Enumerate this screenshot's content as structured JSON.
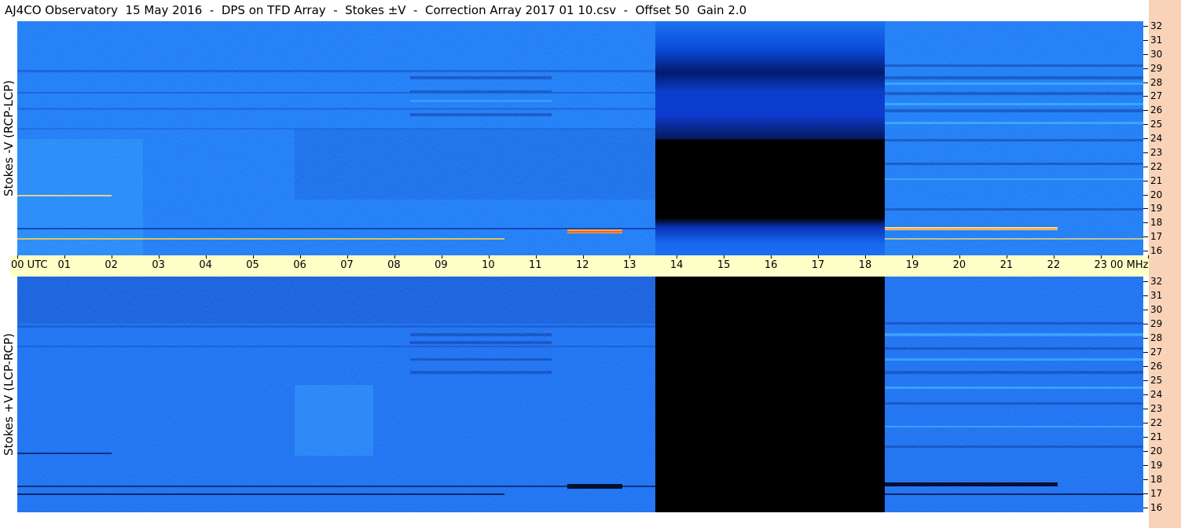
{
  "title": "AJ4CO Observatory  15 May 2016  -  DPS on TFD Array  -  Stokes ±V  -  Correction Array 2017 01 10.csv  -  Offset 50  Gain 2.0",
  "panels": {
    "top": {
      "label": "Stokes -V  (RCP-LCP)"
    },
    "bottom": {
      "label": "Stokes +V  (LCP-RCP)"
    }
  },
  "time_axis": {
    "ticks": [
      "00  UTC",
      "01",
      "02",
      "03",
      "04",
      "05",
      "06",
      "07",
      "08",
      "09",
      "10",
      "11",
      "12",
      "13",
      "14",
      "15",
      "16",
      "17",
      "18",
      "19",
      "20",
      "21",
      "22",
      "23",
      "00 MHz"
    ]
  },
  "frequency_axis": {
    "ticks": [
      "32",
      "31",
      "30",
      "29",
      "28",
      "27",
      "26",
      "25",
      "24",
      "23",
      "22",
      "21",
      "20",
      "19",
      "18",
      "17",
      "16"
    ]
  },
  "colors": {
    "background_blue": "#1f78f5",
    "gap_black": "#000000",
    "axis_band": "#ffffc8",
    "side_strip": "#f8d3b8",
    "interference": "#ffcc44"
  },
  "data_gap": {
    "start_utc": 13.6,
    "end_utc": 18.45
  }
}
